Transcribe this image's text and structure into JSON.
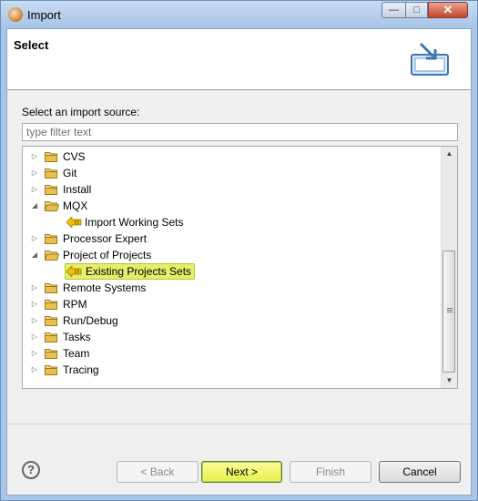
{
  "window": {
    "title": "Import",
    "controls": {
      "minimize": "—",
      "maximize": "□",
      "close": "✕"
    }
  },
  "header": {
    "title": "Select",
    "icon": "import-wizard-icon"
  },
  "source": {
    "label": "Select an import source:",
    "filter_placeholder": "type filter text",
    "filter_value": ""
  },
  "tree": {
    "items": [
      {
        "label": "CVS",
        "type": "folder",
        "expanded": false,
        "level": 0
      },
      {
        "label": "Git",
        "type": "folder",
        "expanded": false,
        "level": 0
      },
      {
        "label": "Install",
        "type": "folder",
        "expanded": false,
        "level": 0
      },
      {
        "label": "MQX",
        "type": "folder",
        "expanded": true,
        "level": 0
      },
      {
        "label": "Import Working Sets",
        "type": "wizard",
        "level": 1
      },
      {
        "label": "Processor Expert",
        "type": "folder",
        "expanded": false,
        "level": 0
      },
      {
        "label": "Project of Projects",
        "type": "folder",
        "expanded": true,
        "level": 0
      },
      {
        "label": "Existing Projects Sets",
        "type": "wizard",
        "level": 1,
        "selected": true
      },
      {
        "label": "Remote Systems",
        "type": "folder",
        "expanded": false,
        "level": 0
      },
      {
        "label": "RPM",
        "type": "folder",
        "expanded": false,
        "level": 0
      },
      {
        "label": "Run/Debug",
        "type": "folder",
        "expanded": false,
        "level": 0
      },
      {
        "label": "Tasks",
        "type": "folder",
        "expanded": false,
        "level": 0
      },
      {
        "label": "Team",
        "type": "folder",
        "expanded": false,
        "level": 0
      },
      {
        "label": "Tracing",
        "type": "folder",
        "expanded": false,
        "level": 0
      }
    ],
    "scroll_position": 1.0
  },
  "buttons": {
    "help": "?",
    "back": "< Back",
    "next": "Next >",
    "finish": "Finish",
    "cancel": "Cancel"
  },
  "colors": {
    "selection": "#e5ef6b",
    "folder": "#e9c04f",
    "wizard_icon": "#f2c20c",
    "titlebar": "#a7c4e6"
  }
}
